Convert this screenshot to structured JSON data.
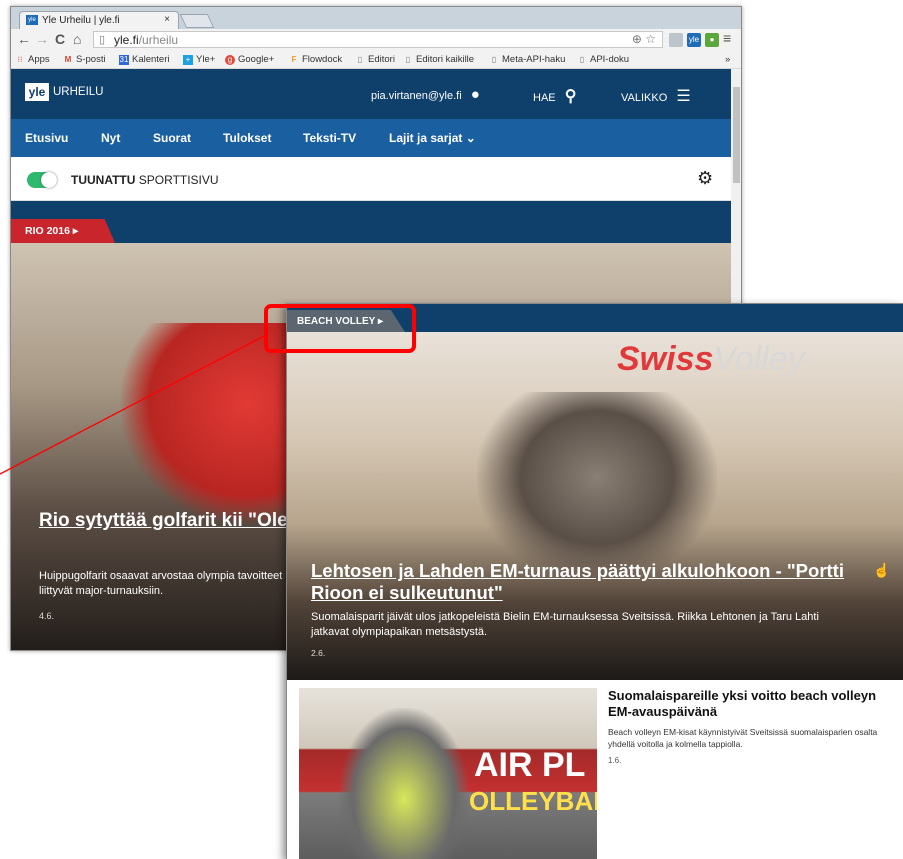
{
  "browser": {
    "tab_title": "Yle Urheilu | yle.fi",
    "tab_close": "×",
    "url_host": "yle.fi",
    "url_path": "/urheilu",
    "nav_back": "←",
    "nav_forward": "→",
    "nav_reload": "C",
    "nav_home": "⌂",
    "bookmarks": [
      "Apps",
      "S-posti",
      "Kalenteri",
      "Yle+",
      "Google+",
      "Flowdock",
      "Editori",
      "Editori kaikille",
      "Meta-API-haku",
      "API-doku"
    ],
    "bookmarks_more": "»"
  },
  "site": {
    "logo": "yle",
    "section": "URHEILU",
    "user": "pia.virtanen@yle.fi",
    "search_label": "HAE",
    "menu_label": "VALIKKO",
    "nav": [
      "Etusivu",
      "Nyt",
      "Suorat",
      "Tulokset",
      "Teksti-TV",
      "Lajit ja sarjat ⌄"
    ],
    "custom_label_bold": "TUUNATTU",
    "custom_label_rest": " SPORTTISIVU",
    "banner_tag": "RIO 2016 ▸",
    "hero": {
      "headline": "Rio sytyttää golfarit kii \"Olen yksi harvoista ja",
      "lead": "Huippugolfarit osaavat arvostaa olympia tavoitteet liittyvät major-turnauksiin.",
      "date": "4.6."
    }
  },
  "zoom": {
    "tag": "BEACH VOLLEY ▸",
    "photo_brand_a": "Swiss",
    "photo_brand_b": "Volley",
    "headline": "Lehtosen ja Lahden EM-turnaus päättyi alkulohkoon - \"Portti Rioon ei sulkeutunut\"",
    "lead": "Suomalaisparit jäivät ulos jatkopeleistä Bielin EM-turnauksessa Sveitsissä. Riikka Lehtonen ja Taru Lahti jatkavat olympiapaikan metsästystä.",
    "date": "2.6.",
    "second": {
      "title": "Suomalaispareille yksi voitto beach volleyn EM-avauspäivänä",
      "lead": "Beach volleyn EM-kisat käynnistyivät Sveitsissä suomalaisparien osalta yhdellä voitolla ja kolmella tappiolla.",
      "date": "1.6.",
      "photo_text_a": "AIR PL",
      "photo_text_b": "OLLEYBALL"
    }
  },
  "colors": {
    "brand_blue": "#0f3f6b",
    "nav_blue": "#1a5f9f",
    "rio_red": "#c9252c",
    "toggle_green": "#2fb86f",
    "highlight_red": "#ff0000"
  }
}
